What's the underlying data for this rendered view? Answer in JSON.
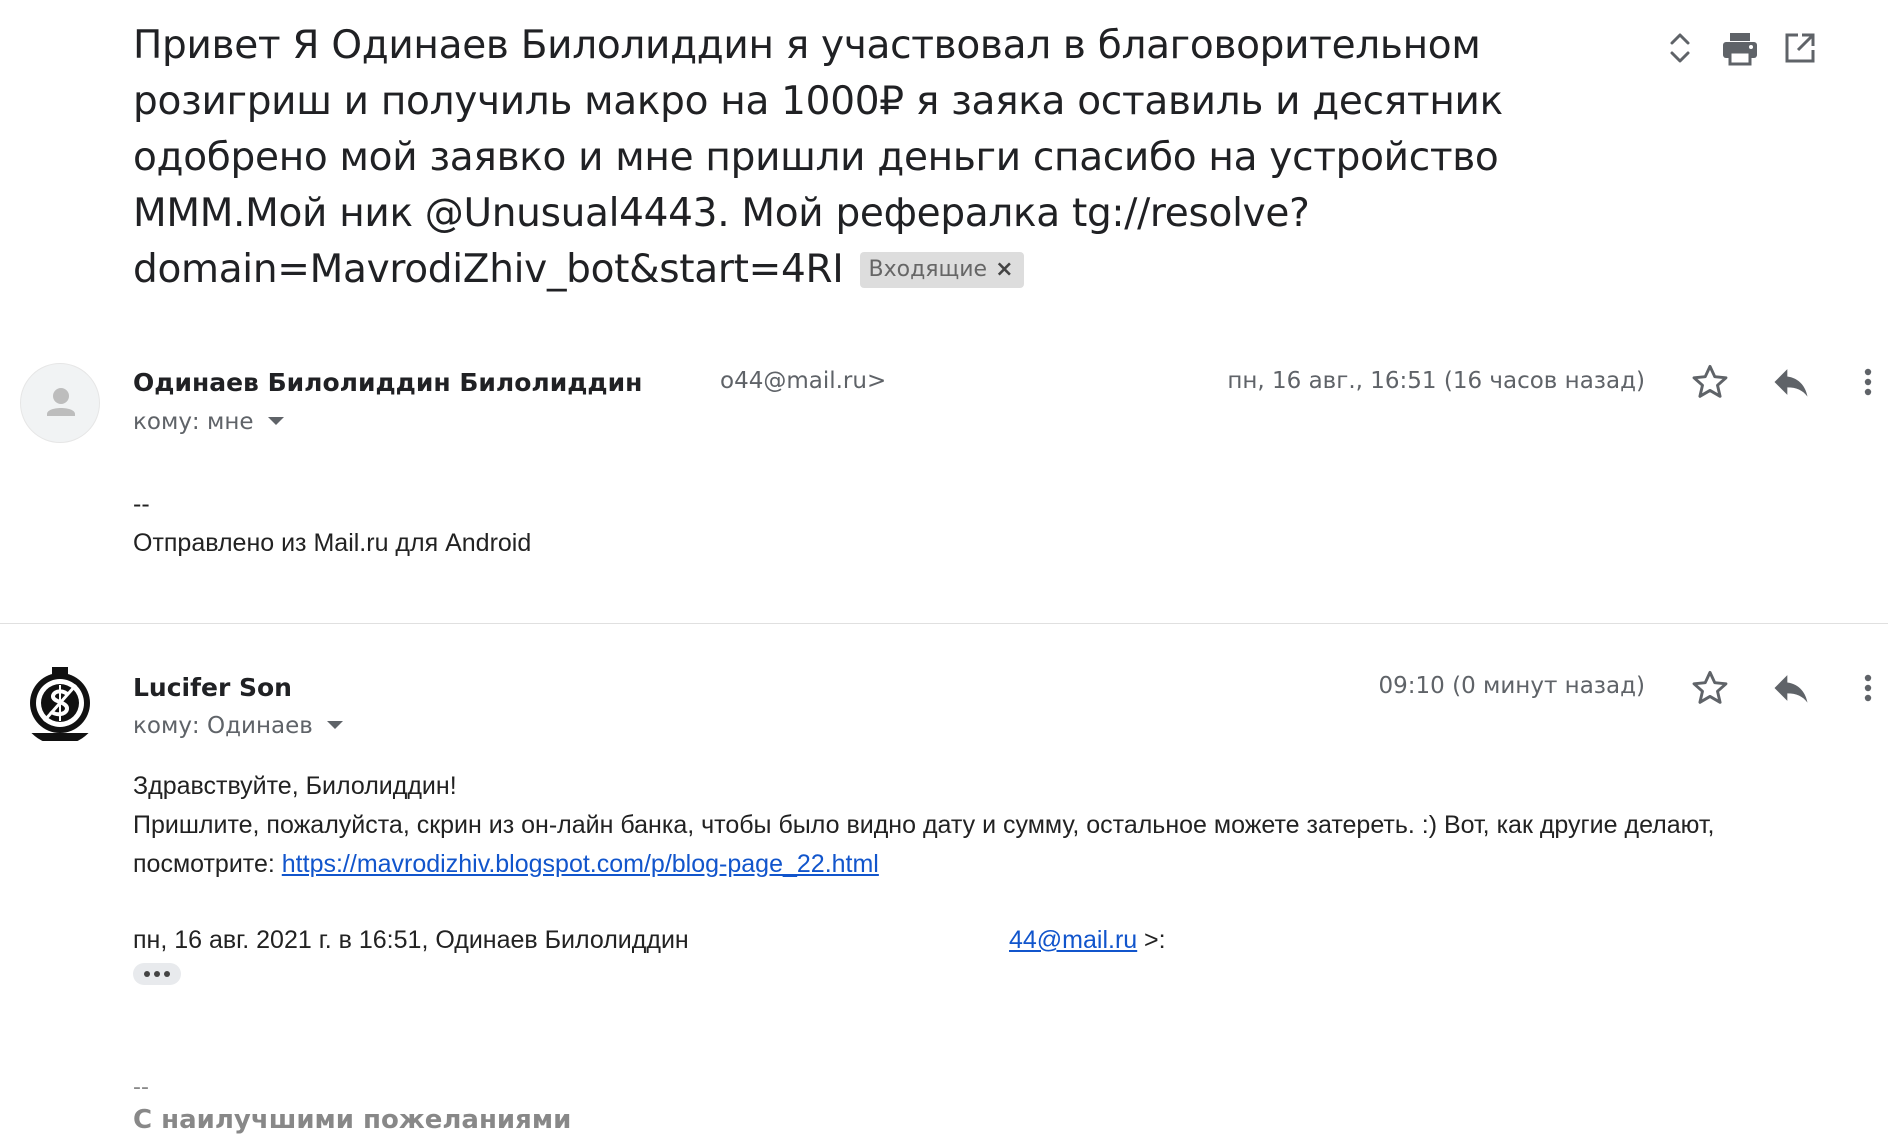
{
  "thread": {
    "subject_lines": [
      "Привет Я Одинаев Билолиддин я участвовал в благоворительном",
      "розигриш и получиль макро на 1000₽ я заяка оставиль и десятник",
      "одобрено мой заявко и мне пришли деньги спасибо на устройство",
      "МММ.Мой ник @Unusual4443. Мой рефералка tg://resolve?",
      "domain=MavrodiZhiv_bot&start=4RI"
    ],
    "label_chip": "Входящие",
    "label_chip_close": "×",
    "actions": {
      "expand_icon": "unfold-icon",
      "print_icon": "print-icon",
      "popout_icon": "open-in-new-window-icon"
    }
  },
  "messages": [
    {
      "sender_name": "Одинаев Билолиддин Билолиддин",
      "sender_email": "o44@mail.ru>",
      "recipient": "кому: мне",
      "timestamp": "пн, 16 авг., 16:51 (16 часов назад)",
      "body": [
        "--",
        "Отправлено из Mail.ru для Android"
      ]
    },
    {
      "sender_name": "Lucifer Son",
      "recipient": "кому: Одинаев",
      "timestamp": "09:10 (0 минут назад)",
      "greeting": "Здравствуйте, Билолиддин!",
      "body_line_1": "Пришлите, пожалуйста, скрин из он-лайн банка, чтобы было видно дату и сумму, остальное можете затереть. :) Вот, как другие делают,",
      "body_line_2_prefix": "посмотрите: ",
      "link": "https://mavrodizhiv.blogspot.com/p/blog-page_22.html",
      "quote_header_prefix": "пн, 16 авг. 2021 г. в 16:51, Одинаев Билолиддин",
      "quote_email_link": "44@mail.ru",
      "quote_header_suffix": ">:",
      "signature_dashes": "--",
      "signature_text": "С наилучшими пожеланиями"
    }
  ],
  "icons": {
    "star": "star-icon",
    "reply": "reply-icon",
    "more": "more-vert-icon"
  },
  "colors": {
    "text": "#202124",
    "secondary": "#5f6368",
    "link": "#1155cc",
    "chip_bg": "#dddddd"
  }
}
